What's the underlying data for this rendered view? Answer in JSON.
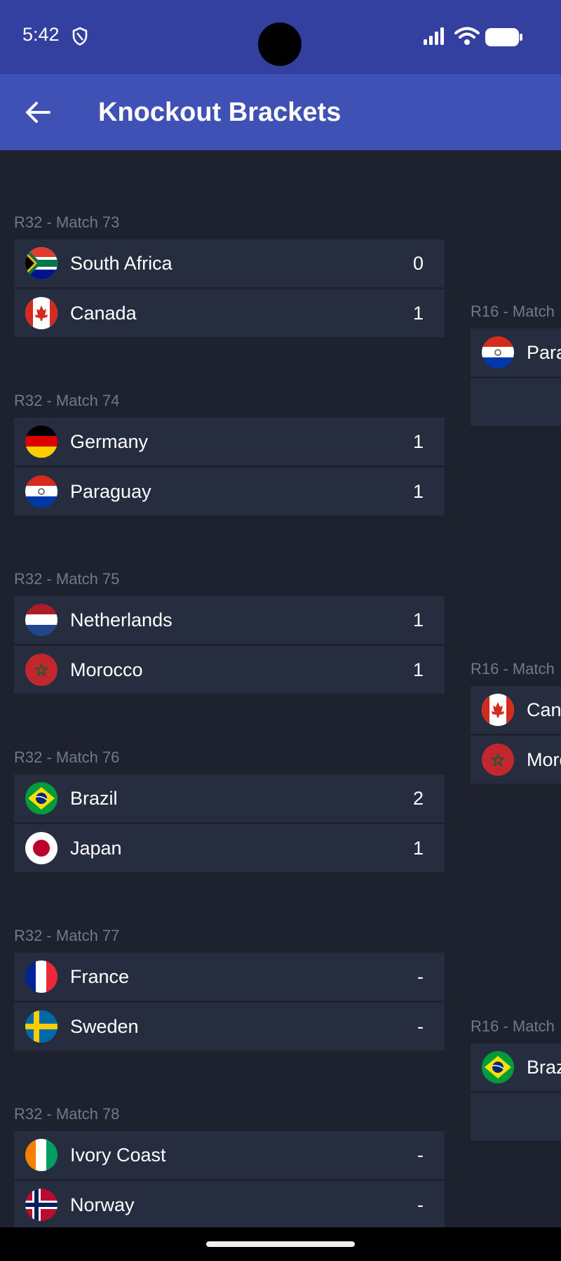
{
  "status": {
    "time": "5:42"
  },
  "app": {
    "title": "Knockout Brackets"
  },
  "r32": [
    {
      "label": "R32 - Match 73",
      "teams": [
        {
          "name": "South Africa",
          "score": "0"
        },
        {
          "name": "Canada",
          "score": "1"
        }
      ]
    },
    {
      "label": "R32 - Match 74",
      "teams": [
        {
          "name": "Germany",
          "score": "1"
        },
        {
          "name": "Paraguay",
          "score": "1"
        }
      ]
    },
    {
      "label": "R32 - Match 75",
      "teams": [
        {
          "name": "Netherlands",
          "score": "1"
        },
        {
          "name": "Morocco",
          "score": "1"
        }
      ]
    },
    {
      "label": "R32 - Match 76",
      "teams": [
        {
          "name": "Brazil",
          "score": "2"
        },
        {
          "name": "Japan",
          "score": "1"
        }
      ]
    },
    {
      "label": "R32 - Match 77",
      "teams": [
        {
          "name": "France",
          "score": "-"
        },
        {
          "name": "Sweden",
          "score": "-"
        }
      ]
    },
    {
      "label": "R32 - Match 78",
      "teams": [
        {
          "name": "Ivory Coast",
          "score": "-"
        },
        {
          "name": "Norway",
          "score": "-"
        }
      ]
    }
  ],
  "r16": [
    {
      "label": "R16 - Match",
      "teams": [
        {
          "name": "Para"
        },
        {
          "name": ""
        }
      ]
    },
    {
      "label": "R16 - Match",
      "teams": [
        {
          "name": "Cana"
        },
        {
          "name": "Moro"
        }
      ]
    },
    {
      "label": "R16 - Match",
      "teams": [
        {
          "name": "Braz"
        },
        {
          "name": ""
        }
      ]
    }
  ],
  "colors": {
    "status_bar": "#3440a0",
    "app_bar": "#3f51b5",
    "background": "#1d222e",
    "card": "#262d3f",
    "label": "#737987"
  },
  "icons": {
    "back": "arrow-left-icon",
    "status": [
      "shield-icon",
      "signal-icon",
      "wifi-icon",
      "battery-icon"
    ]
  }
}
